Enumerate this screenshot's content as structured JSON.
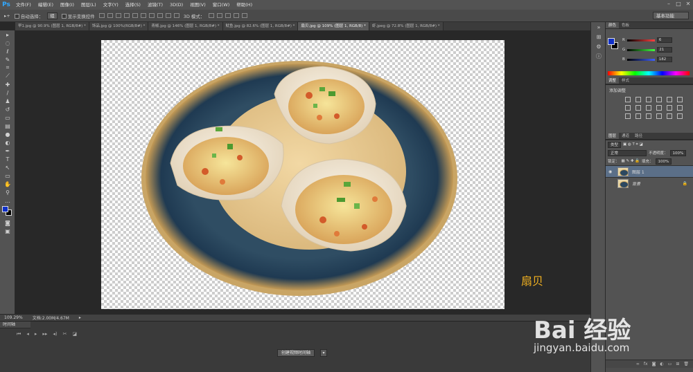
{
  "app": {
    "logo": "Ps"
  },
  "menu": [
    "文件(F)",
    "编辑(E)",
    "图像(I)",
    "图层(L)",
    "文字(Y)",
    "选择(S)",
    "滤镜(T)",
    "3D(D)",
    "视图(V)",
    "窗口(W)",
    "帮助(H)"
  ],
  "options": {
    "auto_select_label": "自动选择：",
    "auto_select_value": "组",
    "transform_controls_label": "显示变换控件",
    "mode_label": "3D 模式：",
    "workspace": "基本功能"
  },
  "tabs": [
    {
      "label": "早1.jpg @ 90.9% (图层 1, RGB/8#) *"
    },
    {
      "label": "饰品.jpg @ 100%(RGB/8#) *"
    },
    {
      "label": "青椒.jpg @ 146% (图层 1, RGB/8#) *"
    },
    {
      "label": "鱿鱼.jpg @ 82.6% (图层 1, RGB/8#) *"
    },
    {
      "label": "扇贝.jpg @ 109% (图层 1, RGB/8) *"
    },
    {
      "label": "虾.jpeg @ 72.8% (图层 1, RGB/8#) *"
    }
  ],
  "canvas": {
    "caption": "扇贝"
  },
  "status": {
    "zoom": "109.29%",
    "doc": "文档:2.00M/4.67M"
  },
  "timeline": {
    "title": "时间轴",
    "create_button": "创建视频时间轴"
  },
  "color_panel": {
    "tabs": [
      "颜色",
      "色板"
    ],
    "sliders": [
      {
        "label": "R",
        "value": "6",
        "color": "#ff4040"
      },
      {
        "label": "G",
        "value": "21",
        "color": "#40ff40"
      },
      {
        "label": "B",
        "value": "182",
        "color": "#4060ff"
      }
    ]
  },
  "adjust_panel": {
    "tabs": [
      "调整",
      "样式"
    ],
    "title": "添加调整"
  },
  "layers_panel": {
    "tabs": [
      "图层",
      "通道",
      "路径"
    ],
    "kind": "类型",
    "blend": "正常",
    "opacity_label": "不透明度：",
    "opacity": "100%",
    "lock_label": "锁定：",
    "fill_label": "填充：",
    "fill": "100%",
    "layers": [
      {
        "name": "图层 1",
        "selected": true
      },
      {
        "name": "背景",
        "selected": false
      }
    ]
  },
  "watermark": {
    "brand": "Bai 经验",
    "url": "jingyan.baidu.com"
  }
}
